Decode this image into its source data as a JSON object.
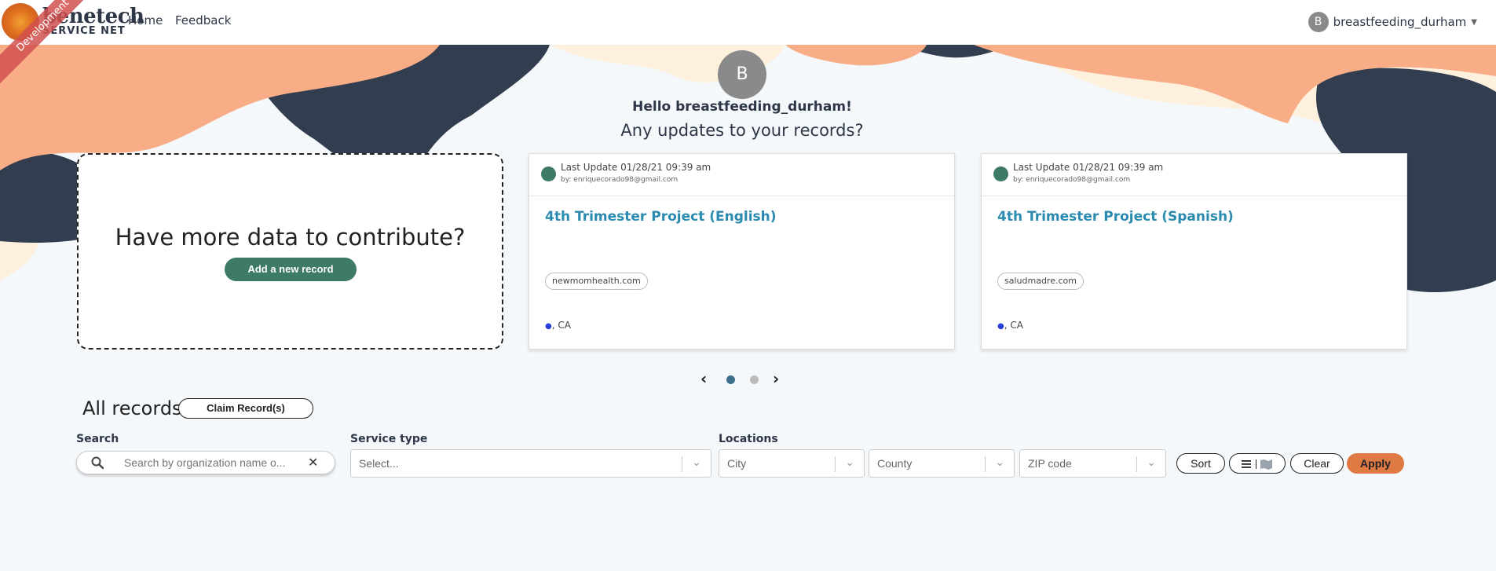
{
  "navbar": {
    "logo_line1": "benetech",
    "logo_line2": "SERVICE NET",
    "dev_ribbon": "Development",
    "links": {
      "home": "Home",
      "feedback": "Feedback"
    },
    "user": {
      "initial": "B",
      "name": "breastfeeding_durham"
    }
  },
  "hero": {
    "avatar_initial": "B",
    "greeting": "Hello breastfeeding_durham!",
    "subtitle": "Any updates to your records?",
    "colors": {
      "peach": "#f8ad86",
      "navy": "#323e4f",
      "cream": "#fdf1de"
    }
  },
  "contribute": {
    "title": "Have more data to contribute?",
    "button": "Add a new record"
  },
  "records_carousel": [
    {
      "last_update": "Last Update 01/28/21 09:39 am",
      "by": "by: enriquecorado98@gmail.com",
      "title": "4th Trimester Project (English)",
      "tag": "newmomhealth.com",
      "location": ", CA"
    },
    {
      "last_update": "Last Update 01/28/21 09:39 am",
      "by": "by: enriquecorado98@gmail.com",
      "title": "4th Trimester Project (Spanish)",
      "tag": "saludmadre.com",
      "location": ", CA"
    }
  ],
  "carousel": {
    "page_count": 2,
    "active_page": 1
  },
  "records": {
    "heading": "All records",
    "claim_button": "Claim Record(s)"
  },
  "filters": {
    "search_label": "Search",
    "search_placeholder": "Search by organization name o...",
    "service_label": "Service type",
    "service_placeholder": "Select...",
    "locations_label": "Locations",
    "city_placeholder": "City",
    "county_placeholder": "County",
    "zip_placeholder": "ZIP code",
    "sort": "Sort",
    "clear": "Clear",
    "apply": "Apply"
  },
  "colors": {
    "accent_green": "#3d7a67",
    "link_blue": "#2a8ab0",
    "apply_orange": "#e07a45"
  }
}
